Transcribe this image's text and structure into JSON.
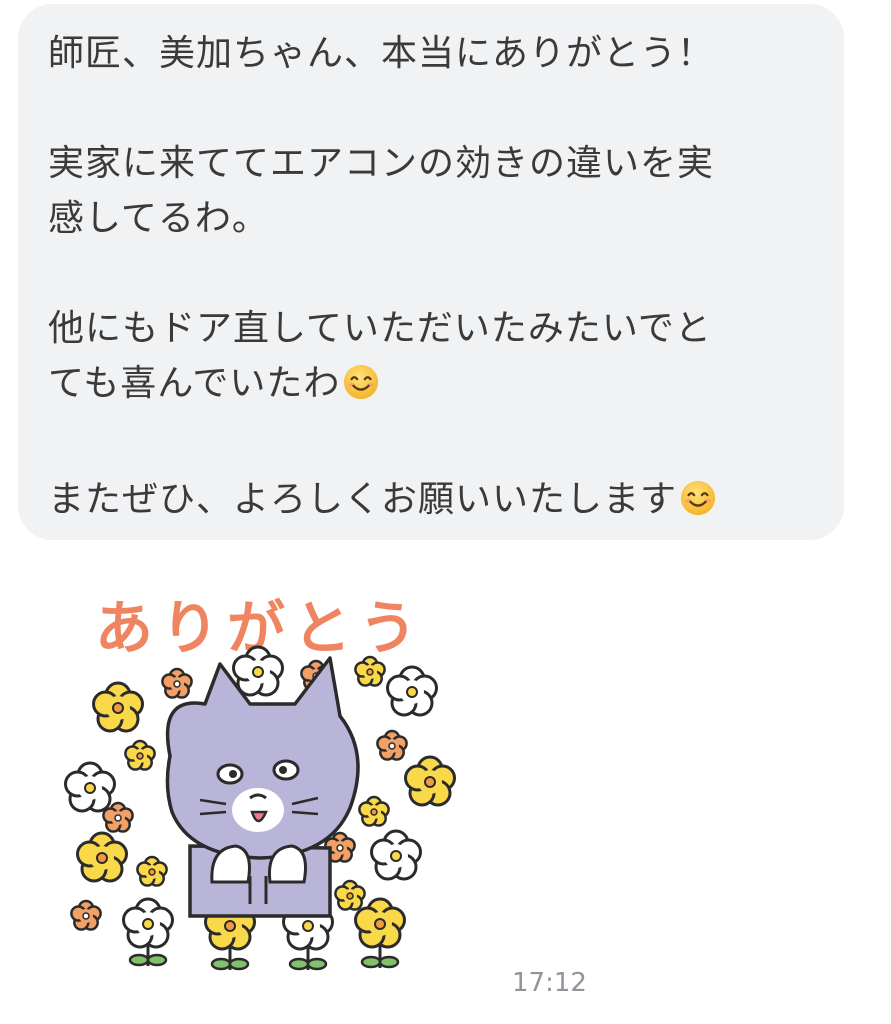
{
  "message": {
    "lines": [
      {
        "text": "師匠、美加ちゃん、本当にありがとう！",
        "emoji": false
      },
      {
        "text": "",
        "emoji": false
      },
      {
        "text": "実家に来ててエアコンの効きの違いを実",
        "emoji": false
      },
      {
        "text": "感してるわ。",
        "emoji": false
      },
      {
        "text": "",
        "emoji": false
      },
      {
        "text": "他にもドア直していただいたみたいでと",
        "emoji": false
      },
      {
        "text": "ても喜んでいたわ",
        "emoji": true
      },
      {
        "text": "",
        "emoji": false
      },
      {
        "text": "またぜひ、よろしくお願いいたします",
        "emoji": true
      }
    ],
    "emoji_icon": "smiling-face-emoji",
    "bubble_color": "#f1f2f4"
  },
  "sticker": {
    "caption": "ありがとう",
    "character": "gray-cat-with-flowers",
    "caption_color": "#ef8560"
  },
  "timestamp": "17:12"
}
